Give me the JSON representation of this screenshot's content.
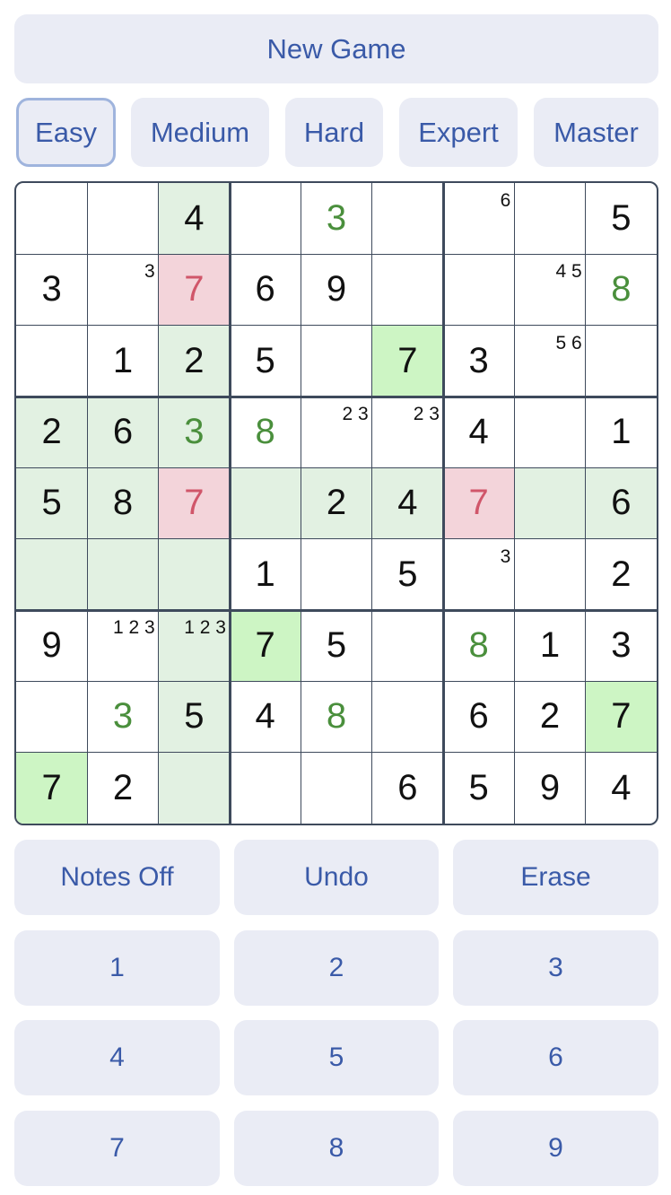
{
  "header": {
    "new_game_label": "New Game"
  },
  "difficulty": [
    {
      "label": "Easy",
      "selected": true
    },
    {
      "label": "Medium",
      "selected": false
    },
    {
      "label": "Hard",
      "selected": false
    },
    {
      "label": "Expert",
      "selected": false
    },
    {
      "label": "Master",
      "selected": false
    }
  ],
  "colors": {
    "given": "#111111",
    "user_correct": "#4a8f3c",
    "user_error": "#d0566a",
    "highlight": "#e2f1e2",
    "same_number": "#cdf5c4",
    "error_bg": "#f3d4da",
    "button_bg": "#eaecf5",
    "button_text": "#3a5aa8",
    "grid": "#3e4a5c"
  },
  "board": [
    [
      {
        "v": ""
      },
      {
        "v": ""
      },
      {
        "v": "4",
        "hl": "h"
      },
      {
        "v": ""
      },
      {
        "v": "3",
        "c": "u"
      },
      {
        "v": ""
      },
      {
        "n": "6"
      },
      {
        "v": ""
      },
      {
        "v": "5"
      }
    ],
    [
      {
        "v": "3"
      },
      {
        "n": "3"
      },
      {
        "v": "7",
        "c": "e",
        "hl": "e"
      },
      {
        "v": "6"
      },
      {
        "v": "9"
      },
      {
        "v": ""
      },
      {
        "v": ""
      },
      {
        "n": "4 5"
      },
      {
        "v": "8",
        "c": "u"
      }
    ],
    [
      {
        "v": ""
      },
      {
        "v": "1"
      },
      {
        "v": "2",
        "hl": "h"
      },
      {
        "v": "5"
      },
      {
        "v": ""
      },
      {
        "v": "7",
        "hl": "s"
      },
      {
        "v": "3"
      },
      {
        "n": "5 6"
      },
      {
        "v": ""
      }
    ],
    [
      {
        "v": "2",
        "hl": "h"
      },
      {
        "v": "6",
        "hl": "h"
      },
      {
        "v": "3",
        "c": "u",
        "hl": "h"
      },
      {
        "v": "8",
        "c": "u"
      },
      {
        "n": "2 3"
      },
      {
        "n": "2 3"
      },
      {
        "v": "4"
      },
      {
        "v": ""
      },
      {
        "v": "1"
      }
    ],
    [
      {
        "v": "5",
        "hl": "h"
      },
      {
        "v": "8",
        "hl": "h"
      },
      {
        "v": "7",
        "c": "e",
        "hl": "e"
      },
      {
        "v": "",
        "hl": "h"
      },
      {
        "v": "2",
        "hl": "h"
      },
      {
        "v": "4",
        "hl": "h"
      },
      {
        "v": "7",
        "c": "e",
        "hl": "e"
      },
      {
        "v": "",
        "hl": "h"
      },
      {
        "v": "6",
        "hl": "h"
      }
    ],
    [
      {
        "v": "",
        "hl": "h"
      },
      {
        "v": "",
        "hl": "h"
      },
      {
        "v": "",
        "hl": "h"
      },
      {
        "v": "1"
      },
      {
        "v": ""
      },
      {
        "v": "5"
      },
      {
        "n": "3"
      },
      {
        "v": ""
      },
      {
        "v": "2"
      }
    ],
    [
      {
        "v": "9"
      },
      {
        "n": "1 2 3"
      },
      {
        "n": "1 2 3",
        "hl": "h"
      },
      {
        "v": "7",
        "hl": "s"
      },
      {
        "v": "5"
      },
      {
        "v": ""
      },
      {
        "v": "8",
        "c": "u"
      },
      {
        "v": "1"
      },
      {
        "v": "3"
      }
    ],
    [
      {
        "v": ""
      },
      {
        "v": "3",
        "c": "u"
      },
      {
        "v": "5",
        "hl": "h"
      },
      {
        "v": "4"
      },
      {
        "v": "8",
        "c": "u"
      },
      {
        "v": ""
      },
      {
        "v": "6"
      },
      {
        "v": "2"
      },
      {
        "v": "7",
        "hl": "s"
      }
    ],
    [
      {
        "v": "7",
        "hl": "s"
      },
      {
        "v": "2"
      },
      {
        "v": "",
        "hl": "h"
      },
      {
        "v": ""
      },
      {
        "v": ""
      },
      {
        "v": "6"
      },
      {
        "v": "5"
      },
      {
        "v": "9"
      },
      {
        "v": "4"
      }
    ]
  ],
  "controls": {
    "notes_label": "Notes Off",
    "undo_label": "Undo",
    "erase_label": "Erase"
  },
  "numpad": [
    "1",
    "2",
    "3",
    "4",
    "5",
    "6",
    "7",
    "8",
    "9"
  ]
}
